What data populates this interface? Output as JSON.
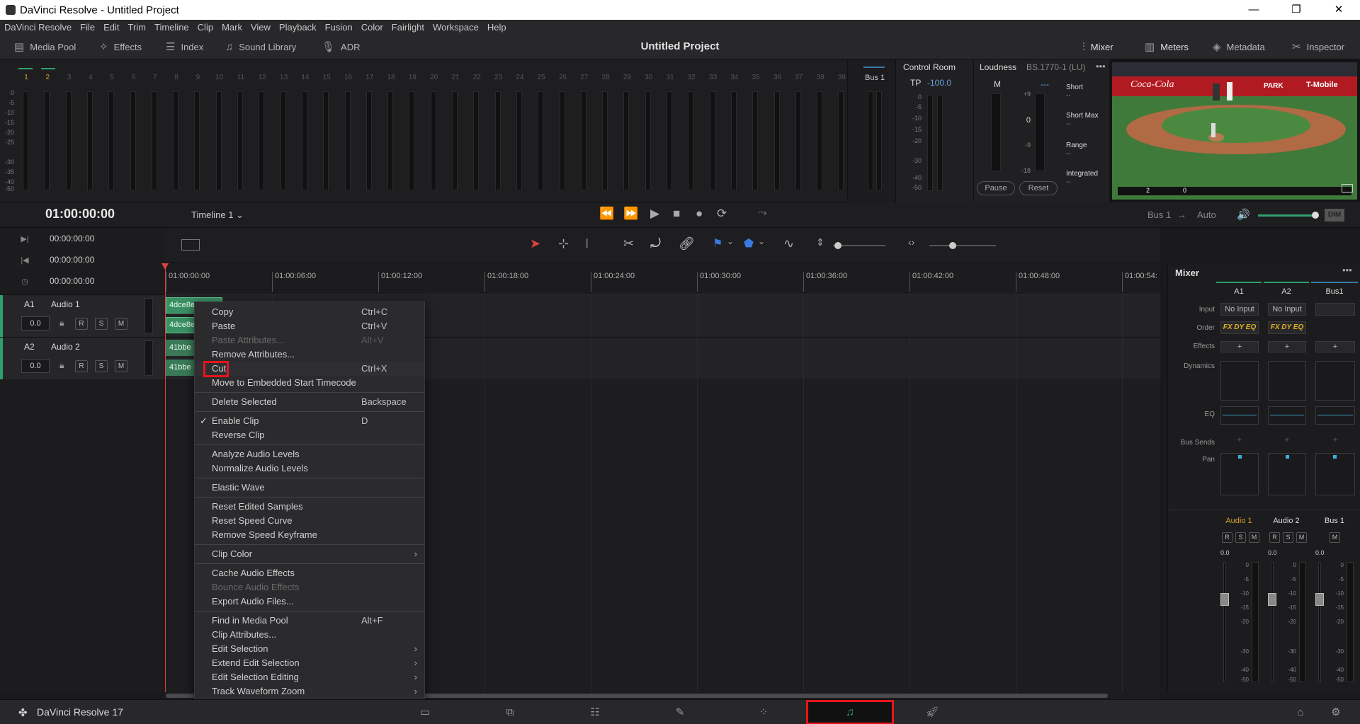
{
  "window": {
    "title": "DaVinci Resolve - Untitled Project",
    "controls": [
      "—",
      "❐",
      "✕"
    ]
  },
  "menu": [
    "DaVinci Resolve",
    "File",
    "Edit",
    "Trim",
    "Timeline",
    "Clip",
    "Mark",
    "View",
    "Playback",
    "Fusion",
    "Color",
    "Fairlight",
    "Workspace",
    "Help"
  ],
  "toolbar": {
    "media_pool": "Media Pool",
    "effects": "Effects",
    "index": "Index",
    "sound_library": "Sound Library",
    "adr": "ADR",
    "project_title": "Untitled Project",
    "mixer": "Mixer",
    "meters": "Meters",
    "metadata": "Metadata",
    "inspector": "Inspector"
  },
  "meters": {
    "channels": [
      "1",
      "2",
      "3",
      "4",
      "5",
      "6",
      "7",
      "8",
      "9",
      "10",
      "11",
      "12",
      "13",
      "14",
      "15",
      "16",
      "17",
      "18",
      "19",
      "20",
      "21",
      "22",
      "23",
      "24",
      "25",
      "26",
      "27",
      "28",
      "29",
      "30",
      "31",
      "32",
      "33",
      "34",
      "35",
      "36",
      "37",
      "38",
      "39"
    ],
    "scale": [
      "0",
      "-5",
      "-10",
      "-15",
      "-20",
      "-25",
      "-30",
      "-35",
      "-40",
      "-50"
    ],
    "bus": "Bus 1"
  },
  "control_room": {
    "title": "Control Room",
    "tp_label": "TP",
    "tp_value": "-100.0",
    "scale": [
      "0",
      "-5",
      "-10",
      "-15",
      "-20",
      "-30",
      "-40",
      "-50"
    ]
  },
  "loudness": {
    "title": "Loudness",
    "standard": "BS.1770-1 (LU)",
    "m_label": "M",
    "m_value": "---",
    "scale": [
      "+9",
      "0",
      "-9",
      "-18"
    ],
    "short": "Short",
    "short_max": "Short Max",
    "range": "Range",
    "integrated": "Integrated",
    "pause": "Pause",
    "reset": "Reset",
    "dash": "--"
  },
  "viewer": {
    "ad1": "Coca-Cola",
    "ad2": "PARK",
    "ad3": "T-Mobile",
    "score": {
      "away": "2",
      "home": "0"
    }
  },
  "transport": {
    "timecode": "01:00:00:00",
    "timeline_name": "Timeline 1",
    "bus": "Bus 1",
    "arrow": "→",
    "auto": "Auto",
    "dim": "DIM"
  },
  "tc_rows": [
    "00:00:00:00",
    "00:00:00:00",
    "00:00:00:00"
  ],
  "tracks": [
    {
      "id": "A1",
      "name": "Audio 1",
      "vol": "0.0",
      "r": "R",
      "s": "S",
      "m": "M"
    },
    {
      "id": "A2",
      "name": "Audio 2",
      "vol": "0.0",
      "r": "R",
      "s": "S",
      "m": "M"
    }
  ],
  "ruler": [
    "01:00:00:00",
    "01:00:06:00",
    "01:00:12:00",
    "01:00:18:00",
    "01:00:24:00",
    "01:00:30:00",
    "01:00:36:00",
    "01:00:42:00",
    "01:00:48:00",
    "01:00:54:"
  ],
  "clips": [
    "4dce8e",
    "4dce8e",
    "41bbe",
    "41bbe"
  ],
  "context_menu": [
    {
      "label": "Copy",
      "shortcut": "Ctrl+C"
    },
    {
      "label": "Paste",
      "shortcut": "Ctrl+V"
    },
    {
      "label": "Paste Attributes...",
      "shortcut": "Alt+V"
    },
    {
      "label": "Remove Attributes...",
      "shortcut": ""
    },
    {
      "label": "Cut",
      "shortcut": "Ctrl+X"
    },
    {
      "label": "Move to Embedded Start Timecode",
      "shortcut": ""
    },
    {
      "label": "Delete Selected",
      "shortcut": "Backspace"
    },
    {
      "label": "Enable Clip",
      "shortcut": "D"
    },
    {
      "label": "Reverse Clip",
      "shortcut": ""
    },
    {
      "label": "Analyze Audio Levels",
      "shortcut": ""
    },
    {
      "label": "Normalize Audio Levels",
      "shortcut": ""
    },
    {
      "label": "Elastic Wave",
      "shortcut": ""
    },
    {
      "label": "Reset Edited Samples",
      "shortcut": ""
    },
    {
      "label": "Reset Speed Curve",
      "shortcut": ""
    },
    {
      "label": "Remove Speed Keyframe",
      "shortcut": ""
    },
    {
      "label": "Clip Color",
      "shortcut": ""
    },
    {
      "label": "Cache Audio Effects",
      "shortcut": ""
    },
    {
      "label": "Bounce Audio Effects",
      "shortcut": ""
    },
    {
      "label": "Export Audio Files...",
      "shortcut": ""
    },
    {
      "label": "Find in Media Pool",
      "shortcut": "Alt+F"
    },
    {
      "label": "Clip Attributes...",
      "shortcut": ""
    },
    {
      "label": "Edit Selection",
      "shortcut": ""
    },
    {
      "label": "Extend Edit Selection",
      "shortcut": ""
    },
    {
      "label": "Edit Selection Editing",
      "shortcut": ""
    },
    {
      "label": "Track Waveform Zoom",
      "shortcut": ""
    }
  ],
  "mixer": {
    "title": "Mixer",
    "columns": [
      "A1",
      "A2",
      "Bus1"
    ],
    "row_labels": {
      "input": "Input",
      "order": "Order",
      "effects": "Effects",
      "dynamics": "Dynamics",
      "eq": "EQ",
      "bus_sends": "Bus Sends",
      "pan": "Pan"
    },
    "inputs": [
      "No Input",
      "No Input",
      ""
    ],
    "order": "FX DY EQ",
    "plus": "+",
    "strip_names": [
      "Audio 1",
      "Audio 2",
      "Bus 1"
    ],
    "vol": [
      "0.0",
      "0.0",
      "0.0"
    ],
    "fader_scale": [
      "0",
      "-5",
      "-10",
      "-15",
      "-20",
      "-30",
      "-40",
      "-50"
    ]
  },
  "bottom": {
    "app": "DaVinci Resolve 17"
  },
  "colors": {
    "accent_green": "#2ea06a",
    "active_orange": "#d6a22c",
    "highlight_red": "#e8141c"
  }
}
